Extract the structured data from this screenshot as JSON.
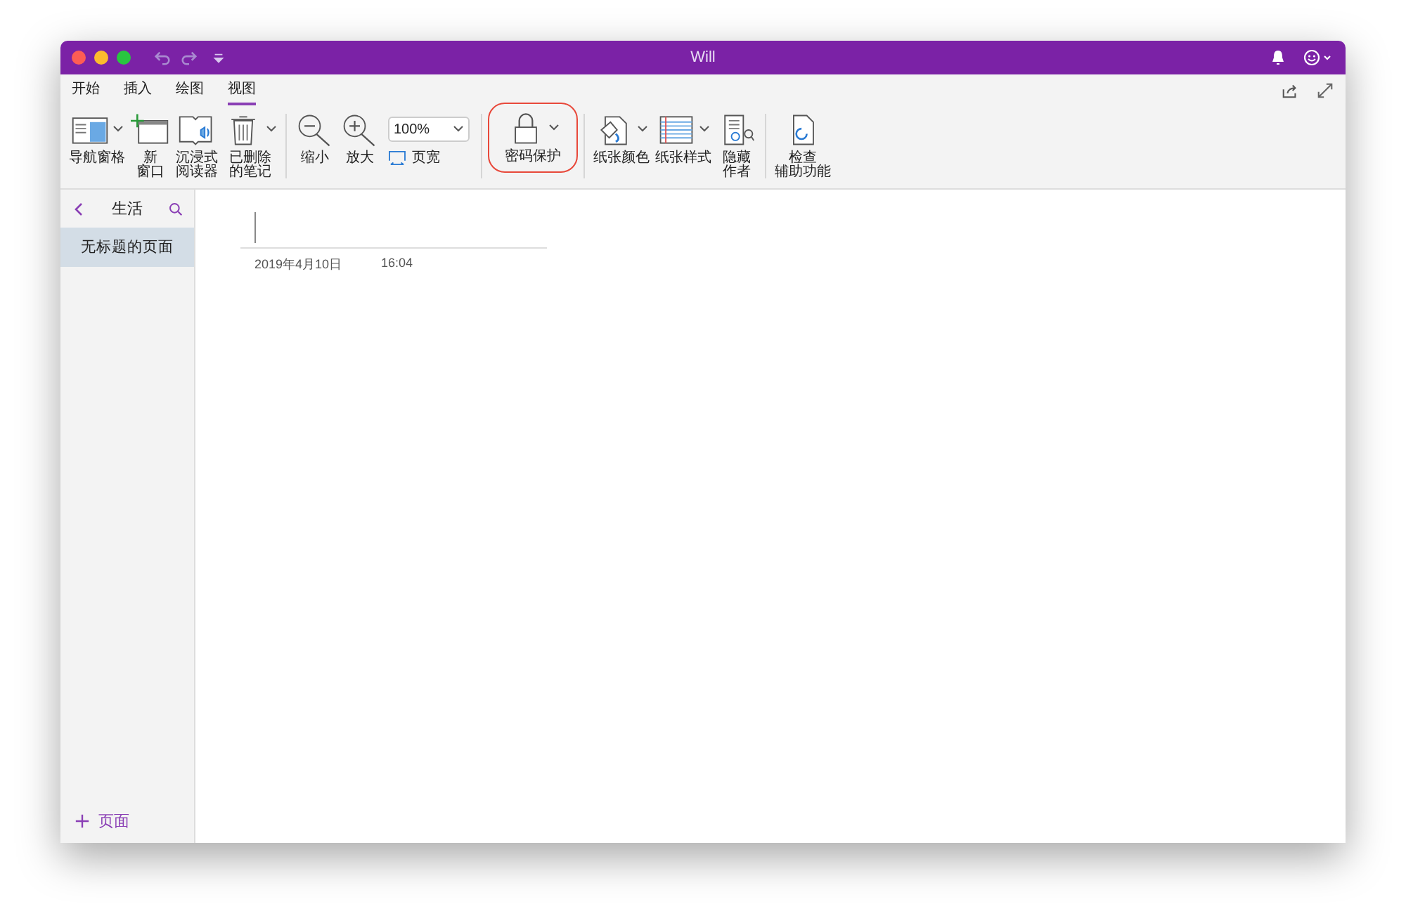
{
  "window": {
    "title": "Will"
  },
  "tabs": [
    {
      "label": "开始",
      "selected": false
    },
    {
      "label": "插入",
      "selected": false
    },
    {
      "label": "绘图",
      "selected": false
    },
    {
      "label": "视图",
      "selected": true
    }
  ],
  "ribbon": [
    {
      "kind": "button",
      "label": [
        "导航窗格"
      ],
      "dropdown": true
    },
    {
      "kind": "button",
      "label": [
        "新",
        "窗口"
      ],
      "dropdown": false
    },
    {
      "kind": "button",
      "label": [
        "沉浸式",
        "阅读器"
      ],
      "dropdown": false
    },
    {
      "kind": "button",
      "label": [
        "已删除",
        "的笔记"
      ],
      "dropdown": true
    },
    {
      "kind": "separator"
    },
    {
      "kind": "button",
      "label": [
        "缩小"
      ],
      "dropdown": false
    },
    {
      "kind": "button",
      "label": [
        "放大"
      ],
      "dropdown": false
    },
    {
      "kind": "zoom",
      "value": "100%",
      "label": "页宽"
    },
    {
      "kind": "separator"
    },
    {
      "kind": "button",
      "label": [
        "密码保护"
      ],
      "dropdown": true,
      "highlighted": true
    },
    {
      "kind": "separator"
    },
    {
      "kind": "button",
      "label": [
        "纸张颜色"
      ],
      "dropdown": true
    },
    {
      "kind": "button",
      "label": [
        "纸张样式"
      ],
      "dropdown": true
    },
    {
      "kind": "button",
      "label": [
        "隐藏",
        "作者"
      ],
      "dropdown": false
    },
    {
      "kind": "separator"
    },
    {
      "kind": "button",
      "label": [
        "检查",
        "辅助功能"
      ],
      "dropdown": false
    }
  ],
  "sidebar": {
    "notebook": "生活",
    "pages": [
      {
        "title": "无标题的页面",
        "selected": true
      }
    ],
    "add_label": "页面"
  },
  "page": {
    "date": "2019年4月10日",
    "time": "16:04"
  }
}
